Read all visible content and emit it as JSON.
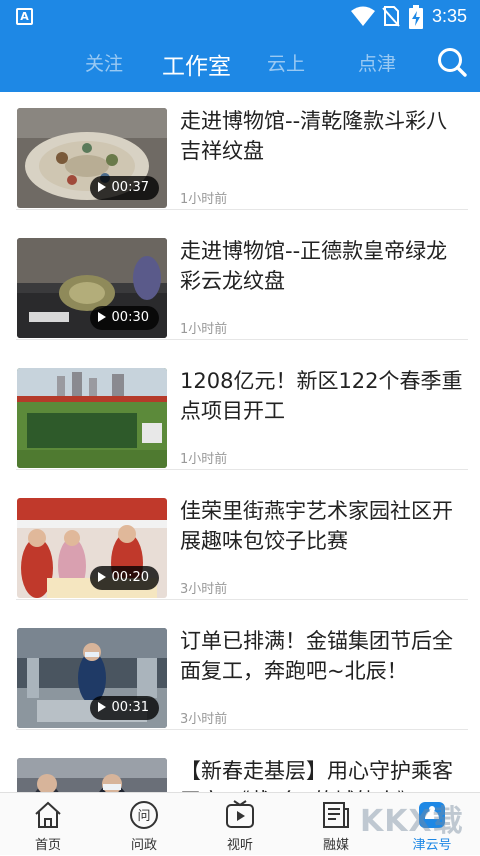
{
  "status_bar": {
    "time": "3:35",
    "app_icon": "A"
  },
  "nav": {
    "tabs": [
      {
        "label": "关注",
        "active": false
      },
      {
        "label": "工作室",
        "active": true
      },
      {
        "label": "云上",
        "active": false
      },
      {
        "label": "点津",
        "active": false
      }
    ]
  },
  "feed": [
    {
      "title": "走进博物馆--清乾隆款斗彩八吉祥纹盘",
      "time": "1小时前",
      "duration": "00:37",
      "thumb": "museum-plate-bright"
    },
    {
      "title": "走进博物馆--正德款皇帝绿龙彩云龙纹盘",
      "time": "1小时前",
      "duration": "00:30",
      "thumb": "museum-plate-dark"
    },
    {
      "title": "1208亿元！新区122个春季重点项目开工",
      "time": "1小时前",
      "duration": "",
      "thumb": "construction-site"
    },
    {
      "title": "佳荣里街燕宇艺术家园社区开展趣味包饺子比赛",
      "time": "3小时前",
      "duration": "00:20",
      "thumb": "dumpling-event"
    },
    {
      "title": "订单已排满！金锚集团节后全面复工，奔跑吧~北辰！",
      "time": "3小时前",
      "duration": "00:31",
      "thumb": "factory-workers"
    },
    {
      "title": "【新春走基层】用心守护乘客平安 《戴“鱼”的城轨人》",
      "time": "",
      "duration": "",
      "thumb": "station-workers"
    }
  ],
  "tabbar": [
    {
      "label": "首页",
      "icon": "home-icon",
      "active": false
    },
    {
      "label": "问政",
      "icon": "ask-icon",
      "active": false
    },
    {
      "label": "视听",
      "icon": "tv-icon",
      "active": false
    },
    {
      "label": "融媒",
      "icon": "news-icon",
      "active": false
    },
    {
      "label": "津云号",
      "icon": "jinyun-icon",
      "active": true
    }
  ],
  "watermark": "KKX载",
  "colors": {
    "primary": "#1e88e5"
  }
}
